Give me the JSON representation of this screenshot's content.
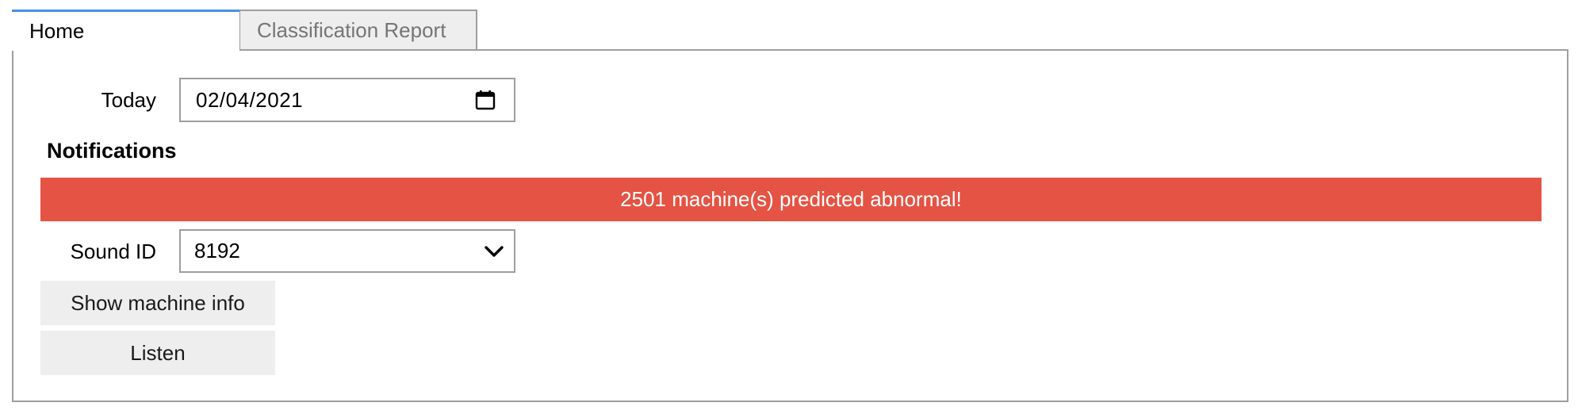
{
  "tabs": [
    {
      "label": "Home",
      "active": true
    },
    {
      "label": "Classification Report",
      "active": false
    }
  ],
  "home": {
    "today_label": "Today",
    "date_value": "02/04/2021",
    "notifications_title": "Notifications",
    "alert_text": "2501 machine(s) predicted abnormal!",
    "sound_id_label": "Sound ID",
    "sound_id_selected": "8192",
    "show_info_label": "Show machine info",
    "listen_label": "Listen"
  },
  "colors": {
    "alert_background": "#e45343",
    "active_tab_accent": "#4a90e2",
    "button_background": "#eeeeee"
  },
  "icons": {
    "date_picker": "calendar-icon",
    "select": "chevron-down-icon"
  }
}
